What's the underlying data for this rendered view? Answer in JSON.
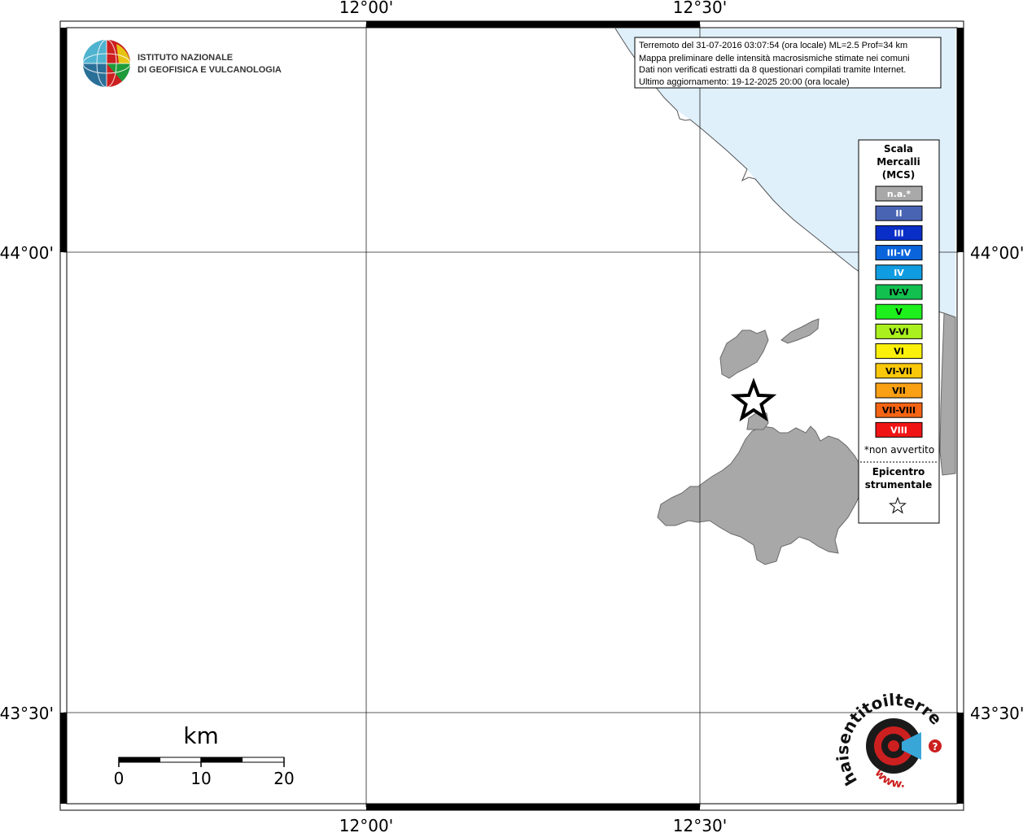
{
  "ticks": {
    "lon_left": "12°00'",
    "lon_right": "12°30'",
    "lat_top": "44°00'",
    "lat_bottom": "43°30'"
  },
  "logo": {
    "line1": "ISTITUTO NAZIONALE",
    "line2": "DI GEOFISICA E VULCANOLOGIA"
  },
  "info_box": {
    "line1": "Terremoto del 31-07-2016 03:07:54 (ora locale) ML=2.5 Prof=34 km",
    "line2": "Mappa preliminare delle intensità macrosismiche stimate nei comuni",
    "line3": "Dati non verificati estratti da 8 questionari compilati tramite Internet.",
    "line4": "Ultimo aggiornamento: 19-12-2025 20:00 (ora locale)"
  },
  "legend": {
    "title1": "Scala",
    "title2": "Mercalli",
    "title3": "(MCS)",
    "items": [
      {
        "label": "n.a.*",
        "color": "#a8a8a8",
        "text_color": "#ffffff"
      },
      {
        "label": "II",
        "color": "#4a64b4",
        "text_color": "#ffffff"
      },
      {
        "label": "III",
        "color": "#0a2ec8",
        "text_color": "#ffffff"
      },
      {
        "label": "III-IV",
        "color": "#0a64dc",
        "text_color": "#ffffff"
      },
      {
        "label": "IV",
        "color": "#109ce0",
        "text_color": "#ffffff"
      },
      {
        "label": "IV-V",
        "color": "#12c050",
        "text_color": "#000000"
      },
      {
        "label": "V",
        "color": "#1ef01e",
        "text_color": "#000000"
      },
      {
        "label": "V-VI",
        "color": "#aaf01e",
        "text_color": "#000000"
      },
      {
        "label": "VI",
        "color": "#faf00a",
        "text_color": "#000000"
      },
      {
        "label": "VI-VII",
        "color": "#fac80a",
        "text_color": "#000000"
      },
      {
        "label": "VII",
        "color": "#faa014",
        "text_color": "#000000"
      },
      {
        "label": "VII-VIII",
        "color": "#f56414",
        "text_color": "#000000"
      },
      {
        "label": "VIII",
        "color": "#f01414",
        "text_color": "#ffffff"
      }
    ],
    "note": "*non avvertito",
    "epi1": "Epicentro",
    "epi2": "strumentale"
  },
  "scale_bar": {
    "unit": "km",
    "n0": "0",
    "n1": "10",
    "n2": "20"
  },
  "badge": {
    "text": "haisentitoilterremoto.it",
    "url_text": "www.",
    "question": "?"
  },
  "colors": {
    "sea": "#dff0fb",
    "land": "#a8a8a8",
    "coast": "#555555",
    "logo_red": "#cc1f1f"
  }
}
